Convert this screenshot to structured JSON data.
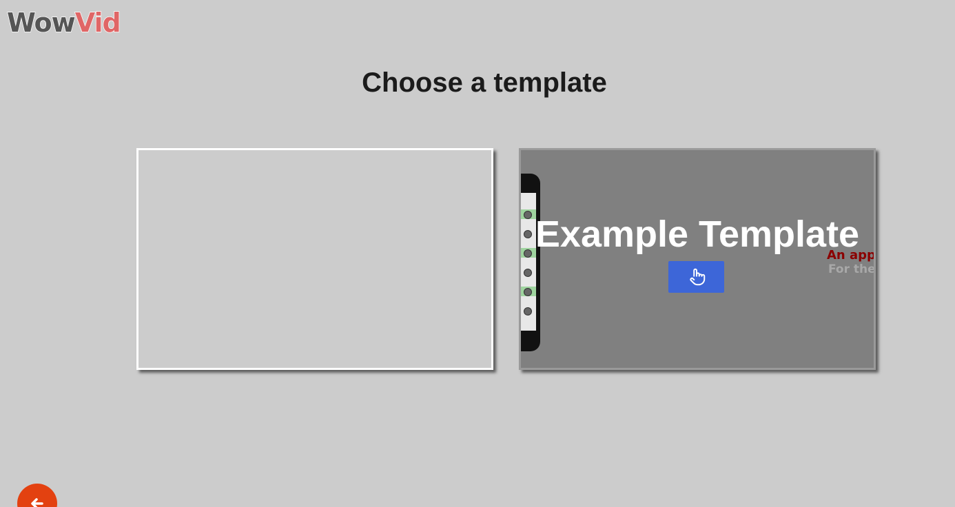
{
  "logo": {
    "part1": "Wow",
    "part2": "Vid"
  },
  "page": {
    "title": "Choose a template"
  },
  "templates": [
    {
      "name": ""
    },
    {
      "name": "Example Template",
      "preview_line1": "An app",
      "preview_line2": "For the"
    }
  ],
  "icons": {
    "select": "pointing-hand-icon",
    "back": "arrow-left-icon"
  },
  "colors": {
    "accent": "#3d66d8",
    "back_button": "#e34110",
    "logo_wow": "#555555",
    "logo_vid": "#e06666"
  }
}
